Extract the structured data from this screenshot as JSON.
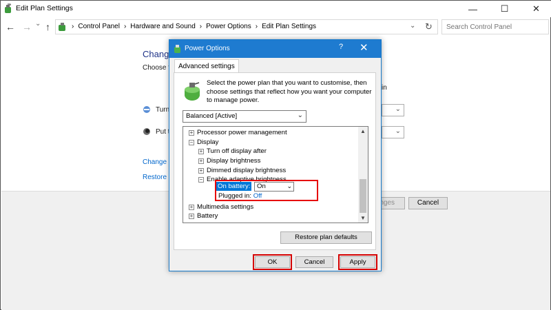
{
  "window": {
    "title": "Edit Plan Settings",
    "minimize": "—",
    "maximize": "☐",
    "close": "✕"
  },
  "nav": {
    "back": "←",
    "forward": "→",
    "dropdown": "⌄",
    "up": "↑",
    "breadcrumbs": [
      "Control Panel",
      "Hardware and Sound",
      "Power Options",
      "Edit Plan Settings"
    ],
    "separator": "›",
    "refresh": "↻",
    "address_dropdown": "⌄",
    "search_placeholder": "Search Control Panel"
  },
  "background": {
    "heading": "Change",
    "subtitle": "Choose t",
    "right_text": "in",
    "row1": "Turn",
    "row2": "Put t",
    "link1": "Change a",
    "link2": "Restore d",
    "save_button": "nges",
    "cancel_button": "Cancel"
  },
  "dialog": {
    "title": "Power Options",
    "help": "?",
    "close": "✕",
    "tab": "Advanced settings",
    "description": "Select the power plan that you want to customise, then choose settings that reflect how you want your computer to manage power.",
    "plan": "Balanced [Active]",
    "tree": {
      "items": [
        {
          "toggle": "+",
          "label": "Processor power management"
        },
        {
          "toggle": "−",
          "label": "Display"
        },
        {
          "toggle": "+",
          "label": "Turn off display after"
        },
        {
          "toggle": "+",
          "label": "Display brightness"
        },
        {
          "toggle": "+",
          "label": "Dimmed display brightness"
        },
        {
          "toggle": "−",
          "label": "Enable adaptive brightness"
        },
        {
          "toggle": "+",
          "label": "Multimedia settings"
        },
        {
          "toggle": "+",
          "label": "Battery"
        }
      ],
      "on_battery_label": "On battery:",
      "on_battery_value": "On",
      "plugged_label": "Plugged in:",
      "plugged_value": "Off"
    },
    "restore_button": "Restore plan defaults",
    "ok_button": "OK",
    "cancel_button": "Cancel",
    "apply_button": "Apply"
  },
  "colors": {
    "accent": "#1e7bd0",
    "highlight_red": "#e60000",
    "link": "#0066cc"
  }
}
